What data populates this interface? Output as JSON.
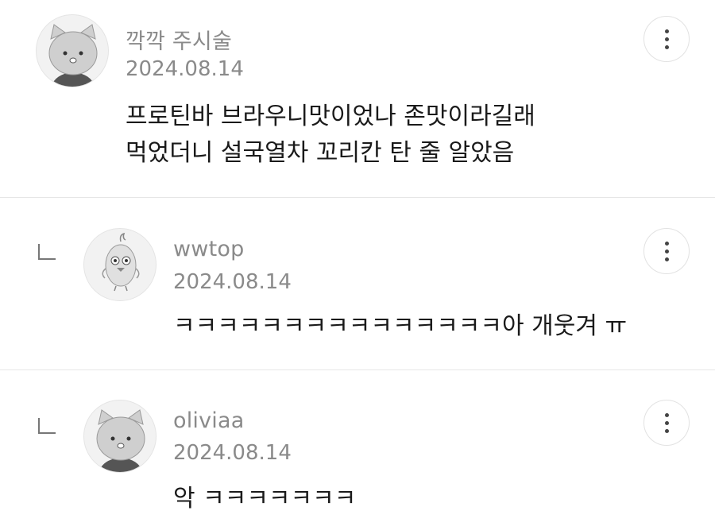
{
  "comments": [
    {
      "author": "깍깍 주시술",
      "date": "2024.08.14",
      "lines": [
        "프로틴바 브라우니맛이었나 존맛이라길래",
        "먹었더니 설국열차 꼬리칸 탄 줄 알았음"
      ],
      "avatar": "cat-avatar",
      "is_reply": false
    },
    {
      "author": "wwtop",
      "date": "2024.08.14",
      "lines": [
        "ㅋㅋㅋㅋㅋㅋㅋㅋㅋㅋㅋㅋㅋㅋㅋ아 개웃겨 ㅠ"
      ],
      "avatar": "chick-avatar",
      "is_reply": true
    },
    {
      "author": "oliviaa",
      "date": "2024.08.14",
      "lines": [
        "악 ㅋㅋㅋㅋㅋㅋㅋ"
      ],
      "avatar": "cat-avatar",
      "is_reply": true
    }
  ],
  "icons": {
    "more": "more-vertical-icon",
    "reply": "reply-arrow-icon"
  },
  "colors": {
    "meta_text": "#8a8a8a",
    "body_text": "#1a1a1a",
    "divider": "#e6e6e6"
  }
}
